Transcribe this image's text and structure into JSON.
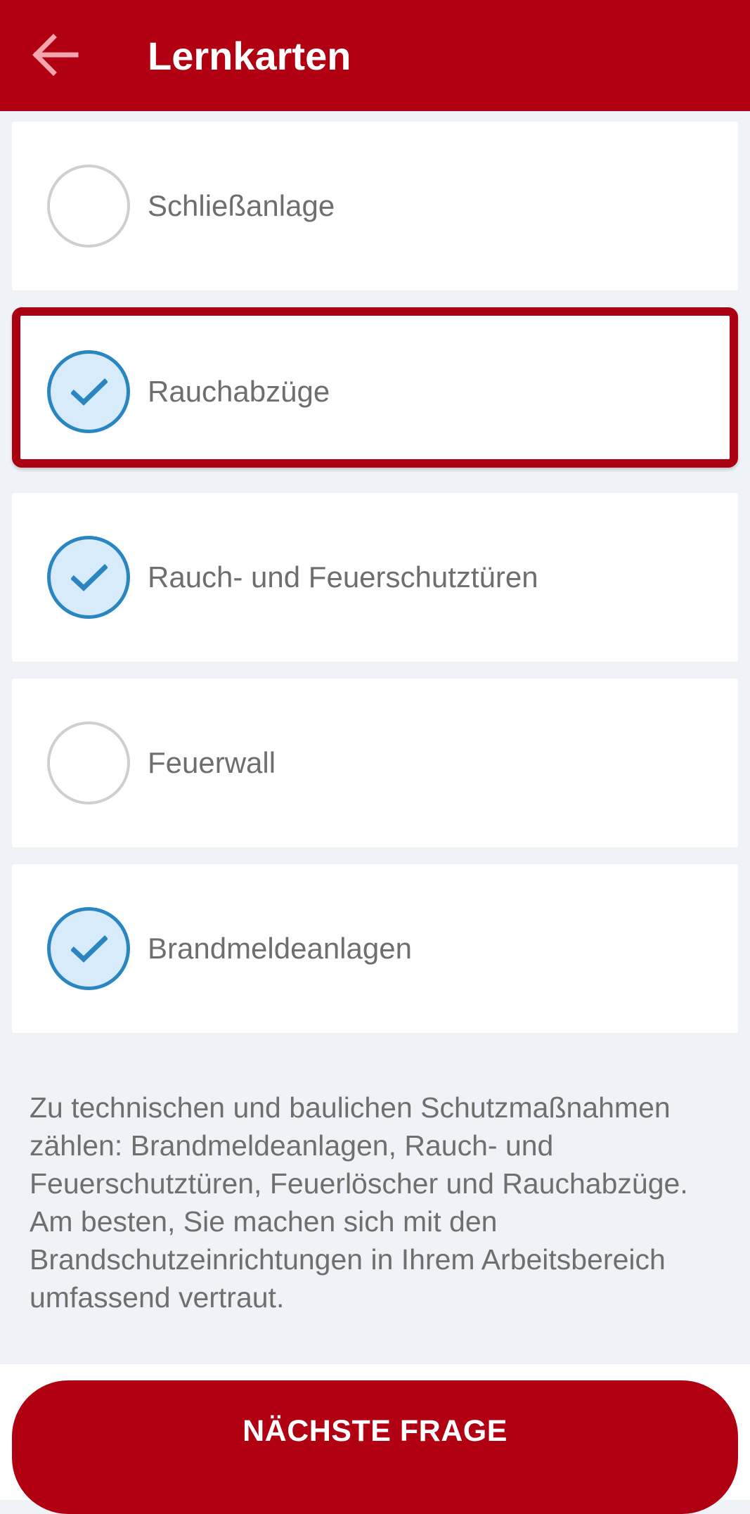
{
  "header": {
    "title": "Lernkarten",
    "back_icon": "arrow-left-icon"
  },
  "options": [
    {
      "label": "Schließanlage",
      "checked": false,
      "highlighted": false
    },
    {
      "label": "Rauchabzüge",
      "checked": true,
      "highlighted": true
    },
    {
      "label": "Rauch- und Feuerschutztüren",
      "checked": true,
      "highlighted": false
    },
    {
      "label": "Feuerwall",
      "checked": false,
      "highlighted": false
    },
    {
      "label": "Brandmeldeanlagen",
      "checked": true,
      "highlighted": false
    }
  ],
  "explanation": "Zu technischen und baulichen Schutzmaßnahmen zählen: Brandmeldeanlagen, Rauch- und Feuerschutztüren, Feuerlöscher und Rauchabzüge. Am besten, Sie machen sich mit den Brandschutzeinrichtungen in Ihrem Arbeitsbereich umfassend vertraut.",
  "footer": {
    "next_label": "NÄCHSTE FRAGE"
  },
  "colors": {
    "brand_red": "#b10012",
    "check_blue": "#2a86c0",
    "check_fill": "#d7ebfb"
  }
}
